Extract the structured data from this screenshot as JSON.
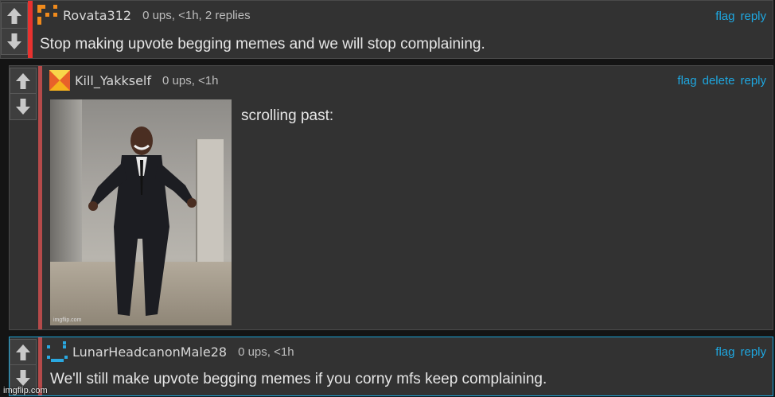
{
  "comments": [
    {
      "username": "Rovata312",
      "meta": "0 ups, <1h, 2 replies",
      "text": "Stop making upvote begging memes and we will stop complaining.",
      "actions": [
        "flag",
        "reply"
      ],
      "accent_color": "#e8322f"
    },
    {
      "username": "Kill_Yakkself",
      "meta": "0 ups, <1h",
      "text": "scrolling past:",
      "actions": [
        "flag",
        "delete",
        "reply"
      ],
      "accent_color": "#b54a4a",
      "image_watermark": "imgflip.com"
    },
    {
      "username": "LunarHeadcanonMale28",
      "meta": "0 ups, <1h",
      "text": "We'll still make upvote begging memes if you corny mfs keep complaining.",
      "actions": [
        "flag",
        "reply"
      ],
      "accent_color": "#b54a4a"
    }
  ],
  "icons": {
    "upvote": "arrow-up-icon",
    "downvote": "arrow-down-icon"
  },
  "watermark": "imgflip.com",
  "colors": {
    "background": "#141414",
    "card": "#323232",
    "link": "#1ea7e0",
    "highlight_border": "#1aa3d6"
  }
}
